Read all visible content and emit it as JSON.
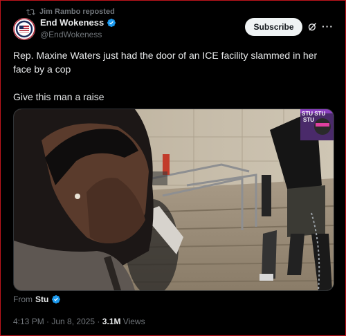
{
  "repost": {
    "text": "Jim Rambo reposted",
    "icon": "repost-icon"
  },
  "author": {
    "name": "End Wokeness",
    "handle": "@EndWokeness",
    "verified_color": "#1d9bf0",
    "avatar": "end-wokeness-logo"
  },
  "header": {
    "subscribe_label": "Subscribe",
    "grok_icon": "grok-icon",
    "more_icon": "more-icon"
  },
  "tweet": {
    "line1": "Rep. Maxine Waters just had the door of an ICE facility slammed in her face by a cop",
    "line2": "Give this man a raise"
  },
  "media": {
    "overlay_text": "STU STU",
    "overlay_text_2": "STU"
  },
  "from": {
    "prefix": "From",
    "name": "Stu"
  },
  "meta": {
    "time": "4:13 PM",
    "separator": " · ",
    "date": "Jun 8, 2025",
    "views": "3.1M",
    "views_label": "Views"
  },
  "colors": {
    "background": "#000000",
    "text": "#e7e9ea",
    "muted": "#71767b",
    "accent": "#1d9bf0",
    "frame": "#c0141c"
  }
}
